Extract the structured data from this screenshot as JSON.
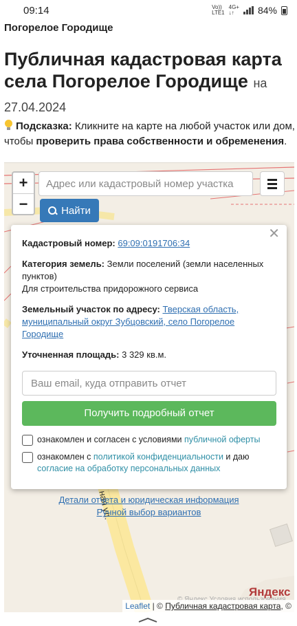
{
  "status_bar": {
    "time": "09:14",
    "network_top": "Vo))",
    "network_bottom": "LTE1",
    "data_top": "4G+",
    "data_bottom": "↓↑",
    "battery": "84%"
  },
  "breadcrumb": "Погорелое Городище",
  "page": {
    "title": "Публичная кадастровая карта села Погорелое Городище",
    "title_suffix": "на 27.04.2024"
  },
  "hint": {
    "label": "Подсказка:",
    "text1": " Кликните на карте на любой участок или дом, чтобы ",
    "bold_text": "проверить права собственности и обременения",
    "text2": "."
  },
  "map_controls": {
    "zoom_in": "+",
    "zoom_out": "−",
    "search_placeholder": "Адрес или кадастровый номер участка",
    "find_label": "Найти"
  },
  "popup": {
    "cadastral_label": "Кадастровый номер:",
    "cadastral_number": "69:09:0191706:34",
    "category_label": "Категория земель:",
    "category_value": "Земли поселений (земли населенных пунктов)",
    "usage": "Для строительства придорожного сервиса",
    "address_label": "Земельный участок по адресу:",
    "address_value": "Тверская область, муниципальный округ Зубцовский, село Погорелое Городище",
    "area_label": "Уточненная площадь:",
    "area_value": "3 329 кв.м.",
    "email_placeholder": "Ваш email, куда отправить отчет",
    "report_button": "Получить подробный отчет",
    "check1_text": "ознакомлен и согласен с условиями ",
    "check1_link": "публичной оферты",
    "check2_text1": "ознакомлен с ",
    "check2_link1": "политикой конфиденциальности",
    "check2_text2": " и даю ",
    "check2_link2": "согласие на обработку персональных данных",
    "link_details": "Детали отчета и юридическая информация",
    "link_manual": "Ручной выбор вариантов"
  },
  "map": {
    "street_label": "ная ул.",
    "yandex_logo": "Яндекс",
    "yandex_terms": "© Яндекс  Условия использования",
    "attribution_leaflet": "Leaflet",
    "attribution_sep": " | © ",
    "attribution_source": "Публичная кадастровая карта",
    "attribution_tail": ", ©"
  },
  "colors": {
    "find_button": "#3679b8",
    "report_button": "#5cb85c",
    "link": "#2f6fb1"
  }
}
